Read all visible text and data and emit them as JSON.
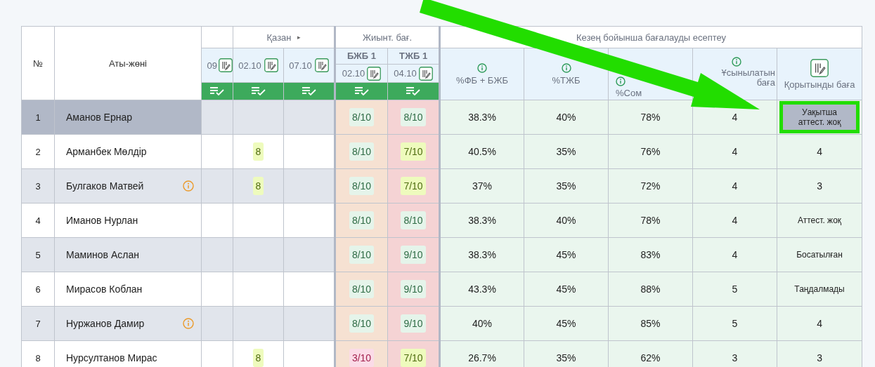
{
  "header": {
    "number_label": "№",
    "name_label": "Аты-жөні",
    "month": "Қазан",
    "month_arrow": "▸",
    "dates": [
      "09",
      "02.10",
      "07.10"
    ],
    "summary": {
      "title": "Жиынт. бағ.",
      "items": [
        {
          "title": "БЖБ 1",
          "date": "02.10"
        },
        {
          "title": "ТЖБ 1",
          "date": "04.10"
        }
      ]
    },
    "period": {
      "title": "Кезең бойынша бағалауды есептеу",
      "columns": [
        {
          "label": "%ФБ + БЖБ"
        },
        {
          "label": "%ТЖБ"
        },
        {
          "label": "%Сом"
        },
        {
          "label": "Ұсынылатын баға"
        },
        {
          "label": "Қорытынды баға"
        }
      ]
    }
  },
  "rows": [
    {
      "num": "1",
      "name": "Аманов Ернар",
      "warning": false,
      "selected": true,
      "marks": [
        {
          "kind": "empty"
        },
        {
          "kind": "empty"
        },
        {
          "kind": "empty"
        }
      ],
      "bjb": {
        "text": "8/10",
        "kind": "good"
      },
      "tjb": {
        "text": "8/10",
        "kind": "good"
      },
      "fb_bjb": "38.3%",
      "tjb_pct": "40%",
      "total_pct": "78%",
      "recommended": "4",
      "final": {
        "text": "Уақытша аттест. жоқ",
        "kind": "box"
      },
      "highlighted": true
    },
    {
      "num": "2",
      "name": "Арманбек Мөлдір",
      "warning": false,
      "selected": false,
      "marks": [
        {
          "kind": "empty"
        },
        {
          "text": "8",
          "kind": "ok"
        },
        {
          "kind": "empty"
        }
      ],
      "bjb": {
        "text": "8/10",
        "kind": "good"
      },
      "tjb": {
        "text": "7/10",
        "kind": "ok"
      },
      "fb_bjb": "40.5%",
      "tjb_pct": "35%",
      "total_pct": "76%",
      "recommended": "4",
      "final": {
        "text": "4",
        "kind": "grade"
      },
      "highlighted": false
    },
    {
      "num": "3",
      "name": "Булгаков Матвей",
      "warning": true,
      "selected": false,
      "marks": [
        {
          "kind": "empty"
        },
        {
          "text": "8",
          "kind": "ok"
        },
        {
          "kind": "empty"
        }
      ],
      "bjb": {
        "text": "8/10",
        "kind": "good"
      },
      "tjb": {
        "text": "7/10",
        "kind": "ok"
      },
      "fb_bjb": "37%",
      "tjb_pct": "35%",
      "total_pct": "72%",
      "recommended": "4",
      "final": {
        "text": "3",
        "kind": "grade"
      },
      "highlighted": false
    },
    {
      "num": "4",
      "name": "Иманов Нурлан",
      "warning": false,
      "selected": false,
      "marks": [
        {
          "kind": "empty"
        },
        {
          "kind": "empty"
        },
        {
          "kind": "empty"
        }
      ],
      "bjb": {
        "text": "8/10",
        "kind": "good"
      },
      "tjb": {
        "text": "8/10",
        "kind": "good"
      },
      "fb_bjb": "38.3%",
      "tjb_pct": "40%",
      "total_pct": "78%",
      "recommended": "4",
      "final": {
        "text": "Аттест. жоқ",
        "kind": "status"
      },
      "highlighted": false
    },
    {
      "num": "5",
      "name": "Маминов Аслан",
      "warning": false,
      "selected": false,
      "marks": [
        {
          "kind": "empty"
        },
        {
          "kind": "empty"
        },
        {
          "kind": "empty"
        }
      ],
      "bjb": {
        "text": "8/10",
        "kind": "good"
      },
      "tjb": {
        "text": "9/10",
        "kind": "good"
      },
      "fb_bjb": "38.3%",
      "tjb_pct": "45%",
      "total_pct": "83%",
      "recommended": "4",
      "final": {
        "text": "Босатылған",
        "kind": "status"
      },
      "highlighted": false
    },
    {
      "num": "6",
      "name": "Мирасов Коблан",
      "warning": false,
      "selected": false,
      "marks": [
        {
          "kind": "empty"
        },
        {
          "kind": "empty"
        },
        {
          "kind": "empty"
        }
      ],
      "bjb": {
        "text": "8/10",
        "kind": "good"
      },
      "tjb": {
        "text": "9/10",
        "kind": "good"
      },
      "fb_bjb": "43.3%",
      "tjb_pct": "45%",
      "total_pct": "88%",
      "recommended": "5",
      "final": {
        "text": "Таңдалмады",
        "kind": "status"
      },
      "highlighted": false
    },
    {
      "num": "7",
      "name": "Нуржанов Дамир",
      "warning": true,
      "selected": false,
      "marks": [
        {
          "kind": "empty"
        },
        {
          "kind": "empty"
        },
        {
          "kind": "empty"
        }
      ],
      "bjb": {
        "text": "8/10",
        "kind": "good"
      },
      "tjb": {
        "text": "9/10",
        "kind": "good"
      },
      "fb_bjb": "40%",
      "tjb_pct": "45%",
      "total_pct": "85%",
      "recommended": "5",
      "final": {
        "text": "4",
        "kind": "grade"
      },
      "highlighted": false
    },
    {
      "num": "8",
      "name": "Нурсултанов Мирас",
      "warning": false,
      "selected": false,
      "marks": [
        {
          "kind": "empty"
        },
        {
          "text": "8",
          "kind": "ok"
        },
        {
          "kind": "empty"
        }
      ],
      "bjb": {
        "text": "3/10",
        "kind": "bad"
      },
      "tjb": {
        "text": "7/10",
        "kind": "ok"
      },
      "fb_bjb": "26.7%",
      "tjb_pct": "35%",
      "total_pct": "62%",
      "recommended": "3",
      "final": {
        "text": "3",
        "kind": "grade"
      },
      "highlighted": false
    }
  ]
}
